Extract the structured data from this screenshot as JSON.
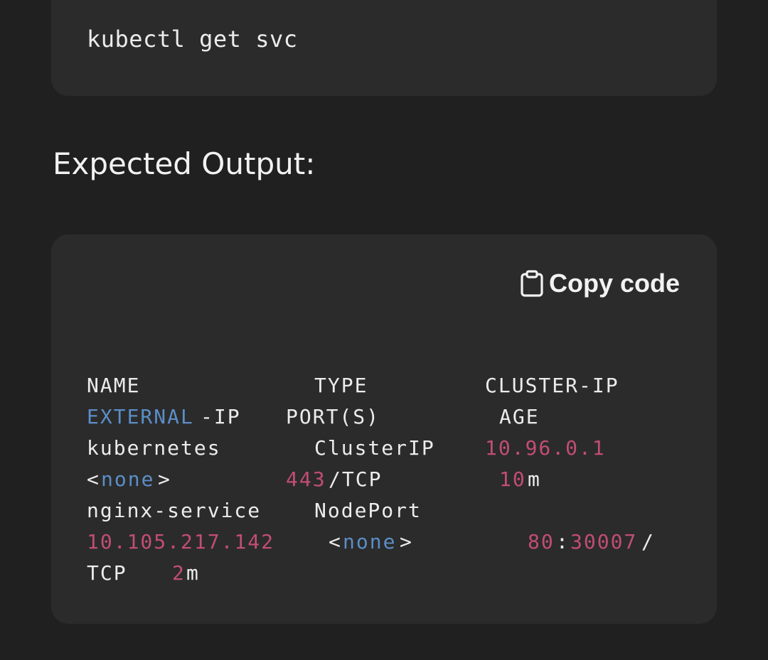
{
  "colors": {
    "background": "#202020",
    "code_block": "#2b2b2b",
    "text": "#ececec",
    "keyword_blue": "#5b8ec7",
    "number_pink": "#c24d74"
  },
  "command_block": {
    "command": "kubectl get svc"
  },
  "section": {
    "heading": "Expected Output:"
  },
  "output_block": {
    "copy_button": {
      "icon": "clipboard-icon",
      "label": "Copy code"
    },
    "lines": [
      [
        {
          "text": "NAME",
          "color": "default"
        },
        {
          "text": "TYPE",
          "color": "default"
        },
        {
          "text": "CLUSTER-IP",
          "color": "default"
        }
      ],
      [
        {
          "text": "EXTERNAL",
          "color": "blue"
        },
        {
          "text": "-IP",
          "color": "default"
        },
        {
          "text": "PORT(S)",
          "color": "default"
        },
        {
          "text": "AGE",
          "color": "default"
        }
      ],
      [
        {
          "text": "kubernetes",
          "color": "default"
        },
        {
          "text": "ClusterIP",
          "color": "default"
        },
        {
          "text": "10.96.0.1",
          "color": "pink"
        }
      ],
      [
        {
          "text": "<",
          "color": "default"
        },
        {
          "text": "none",
          "color": "blue"
        },
        {
          "text": ">",
          "color": "default"
        },
        {
          "text": "443",
          "color": "pink"
        },
        {
          "text": "/TCP",
          "color": "default"
        },
        {
          "text": "10",
          "color": "pink"
        },
        {
          "text": "m",
          "color": "default"
        }
      ],
      [
        {
          "text": "nginx-service",
          "color": "default"
        },
        {
          "text": "NodePort",
          "color": "default"
        }
      ],
      [
        {
          "text": "10.105.217.142",
          "color": "pink"
        },
        {
          "text": "<",
          "color": "default"
        },
        {
          "text": "none",
          "color": "blue"
        },
        {
          "text": ">",
          "color": "default"
        },
        {
          "text": "80",
          "color": "pink"
        },
        {
          "text": ":",
          "color": "default"
        },
        {
          "text": "30007",
          "color": "pink"
        },
        {
          "text": "/",
          "color": "default"
        }
      ],
      [
        {
          "text": "TCP",
          "color": "default"
        },
        {
          "text": "2",
          "color": "pink"
        },
        {
          "text": "m",
          "color": "default"
        }
      ]
    ]
  }
}
